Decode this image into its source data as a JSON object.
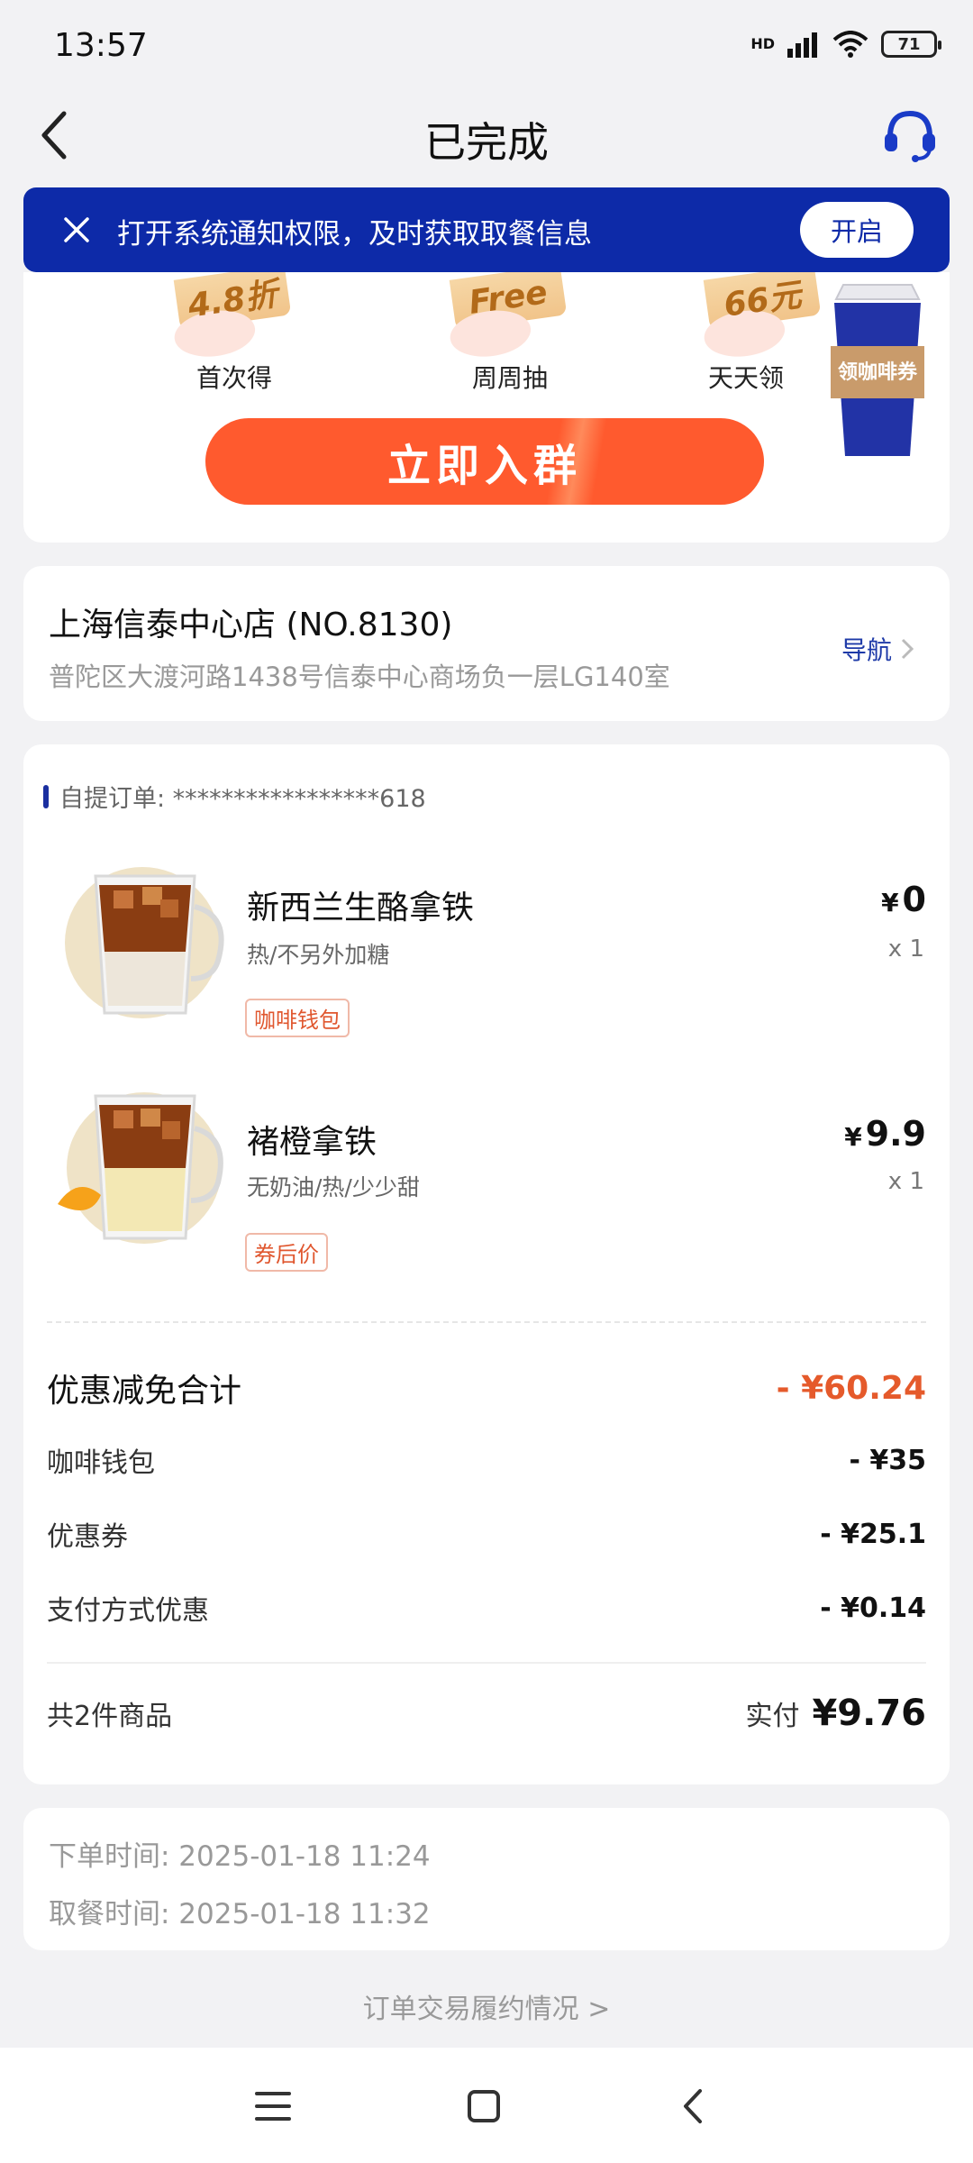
{
  "status_bar": {
    "time": "13:57",
    "network": "HD",
    "battery": "71"
  },
  "header": {
    "title": "已完成"
  },
  "notice": {
    "text": "打开系统通知权限，及时获取取餐信息",
    "button": "开启"
  },
  "promo": {
    "perks": [
      {
        "tag": "4.8折",
        "label": "首次得"
      },
      {
        "tag": "Free",
        "label": "周周抽"
      },
      {
        "tag": "66元",
        "label": "天天领"
      }
    ],
    "join_button": "立即入群",
    "cup_text": "领咖啡券"
  },
  "store": {
    "name": "上海信泰中心店 (NO.8130)",
    "address": "普陀区大渡河路1438号信泰中心商场负一层LG140室",
    "nav_label": "导航"
  },
  "order": {
    "label": "自提订单: *****************618",
    "items": [
      {
        "name": "新西兰生酪拿铁",
        "spec": "热/不另外加糖",
        "tag": "咖啡钱包",
        "price_symbol": "¥",
        "price": "0",
        "qty": "x 1"
      },
      {
        "name": "褚橙拿铁",
        "spec": "无奶油/热/少少甜",
        "tag": "券后价",
        "price_symbol": "¥",
        "price": "9.9",
        "qty": "x 1"
      }
    ],
    "discount_total": {
      "label": "优惠减免合计",
      "value": "- ¥60.24"
    },
    "discounts": [
      {
        "label": "咖啡钱包",
        "value": "- ¥35"
      },
      {
        "label": "优惠券",
        "value": "- ¥25.1"
      },
      {
        "label": "支付方式优惠",
        "value": "- ¥0.14"
      }
    ],
    "count_label": "共2件商品",
    "paid_label": "实付",
    "paid_value": "¥9.76"
  },
  "times": {
    "order_time": "下单时间:  2025-01-18 11:24",
    "pickup_time": "取餐时间:  2025-01-18 11:32"
  },
  "trace_link": "订单交易履约情况 >",
  "colors": {
    "brand_blue": "#0d2aa8",
    "accent_orange": "#ff5a2e",
    "discount_red": "#e55a2b"
  }
}
